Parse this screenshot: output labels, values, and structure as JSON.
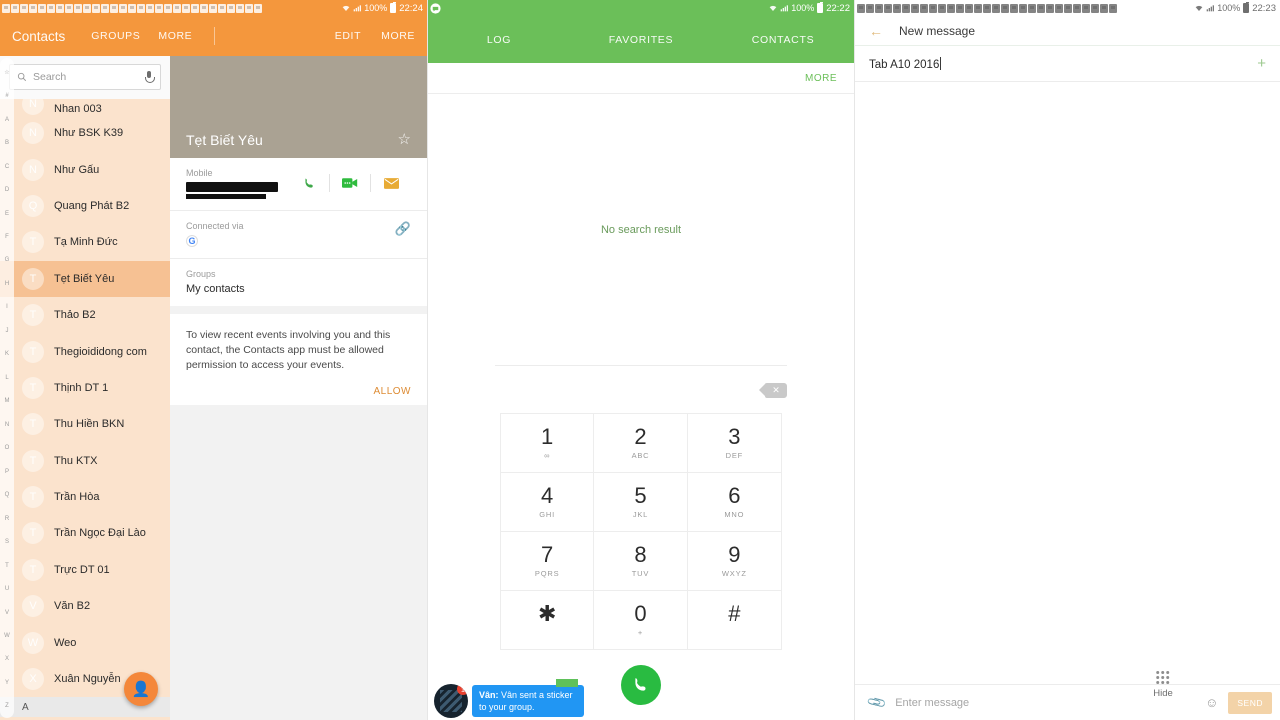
{
  "contacts_app": {
    "status": {
      "clock": "22:24",
      "battery_pct": "100%",
      "notif_count": 29
    },
    "appbar": {
      "title": "Contacts",
      "tab_groups": "GROUPS",
      "tab_more": "MORE",
      "action_edit": "EDIT",
      "action_more": "MORE"
    },
    "search": {
      "placeholder": "Search",
      "icon": "search-icon",
      "mic_icon": "microphone-icon"
    },
    "index_letters": [
      "☆",
      "#",
      "A",
      "B",
      "C",
      "D",
      "E",
      "F",
      "G",
      "H",
      "I",
      "J",
      "K",
      "L",
      "M",
      "N",
      "O",
      "P",
      "Q",
      "R",
      "S",
      "T",
      "U",
      "V",
      "W",
      "X",
      "Y",
      "Z"
    ],
    "list": [
      {
        "initial": "N",
        "name": "Nhan 003",
        "selected": false,
        "partial": true
      },
      {
        "initial": "N",
        "name": "Như BSK K39",
        "selected": false
      },
      {
        "initial": "N",
        "name": "Như Gấu",
        "selected": false
      },
      {
        "initial": "Q",
        "name": "Quang Phát B2",
        "selected": false
      },
      {
        "initial": "T",
        "name": "Tạ Minh Đức",
        "selected": false
      },
      {
        "initial": "T",
        "name": "Tẹt Biết Yêu",
        "selected": true
      },
      {
        "initial": "T",
        "name": "Thảo B2",
        "selected": false
      },
      {
        "initial": "T",
        "name": "Thegioididong com",
        "selected": false
      },
      {
        "initial": "T",
        "name": "Thịnh DT 1",
        "selected": false
      },
      {
        "initial": "T",
        "name": "Thu Hiền BKN",
        "selected": false
      },
      {
        "initial": "T",
        "name": "Thu KTX",
        "selected": false
      },
      {
        "initial": "T",
        "name": "Trần Hòa",
        "selected": false
      },
      {
        "initial": "T",
        "name": "Trần Ngọc Đại Lào",
        "selected": false
      },
      {
        "initial": "T",
        "name": "Trực DT 01",
        "selected": false
      },
      {
        "initial": "V",
        "name": "Văn B2",
        "selected": false
      },
      {
        "initial": "W",
        "name": "Weo",
        "selected": false
      },
      {
        "initial": "X",
        "name": "Xuân Nguyễn",
        "selected": false
      }
    ],
    "section_footer": "A",
    "fab": {
      "icon": "add-contact-icon",
      "color": "#f4873a"
    },
    "detail": {
      "name": "Tẹt Biết Yêu",
      "favorite_icon": "star-outline-icon",
      "phone_label": "Mobile",
      "phone_value_redacted": true,
      "action_call": "phone-icon",
      "action_video": "video-call-icon",
      "action_message": "message-icon",
      "connected_label": "Connected via",
      "connected_account": "G",
      "link_icon": "link-icon",
      "groups_label": "Groups",
      "groups_value": "My contacts",
      "permission_text": "To view recent events involving you and this contact, the Contacts app must be allowed permission to access your events.",
      "permission_action": "ALLOW"
    }
  },
  "dialer_app": {
    "status": {
      "clock": "22:22",
      "battery_pct": "100%"
    },
    "tabs": [
      "LOG",
      "FAVORITES",
      "CONTACTS"
    ],
    "more_label": "MORE",
    "empty_text": "No search result",
    "dial_value": "",
    "backspace_icon": "backspace-icon",
    "keys": [
      {
        "digit": "1",
        "sub": "∞"
      },
      {
        "digit": "2",
        "sub": "ABC"
      },
      {
        "digit": "3",
        "sub": "DEF"
      },
      {
        "digit": "4",
        "sub": "GHI"
      },
      {
        "digit": "5",
        "sub": "JKL"
      },
      {
        "digit": "6",
        "sub": "MNO"
      },
      {
        "digit": "7",
        "sub": "PQRS"
      },
      {
        "digit": "8",
        "sub": "TUV"
      },
      {
        "digit": "9",
        "sub": "WXYZ"
      },
      {
        "digit": "✱",
        "sub": ""
      },
      {
        "digit": "0",
        "sub": "+"
      },
      {
        "digit": "#",
        "sub": ""
      }
    ],
    "call_button_icon": "call-icon",
    "hide_label": "Hide",
    "hide_icon": "keypad-icon",
    "chat_head": {
      "badge": "1",
      "sender": "Vân:",
      "message": " Vân sent a sticker to your group.",
      "avatar_icon": "chat-head-avatar"
    }
  },
  "messages_app": {
    "status": {
      "clock": "22:23",
      "battery_pct": "100%"
    },
    "back_icon": "back-arrow-icon",
    "title": "New message",
    "recipient_value": "Tab A10 2016",
    "add_recipient_icon": "plus-icon",
    "compose": {
      "attach_icon": "paperclip-icon",
      "placeholder": "Enter message",
      "emoji_icon": "smiley-icon",
      "send_label": "SEND"
    }
  },
  "colors": {
    "contacts_accent": "#f4973d",
    "contacts_list_bg": "#fbe3cd",
    "contacts_selected": "#f6c193",
    "dialer_accent": "#6bbf59",
    "call_green": "#29bb41",
    "photo_bg": "#aaa293",
    "send_disabled": "#f3d3a8"
  }
}
